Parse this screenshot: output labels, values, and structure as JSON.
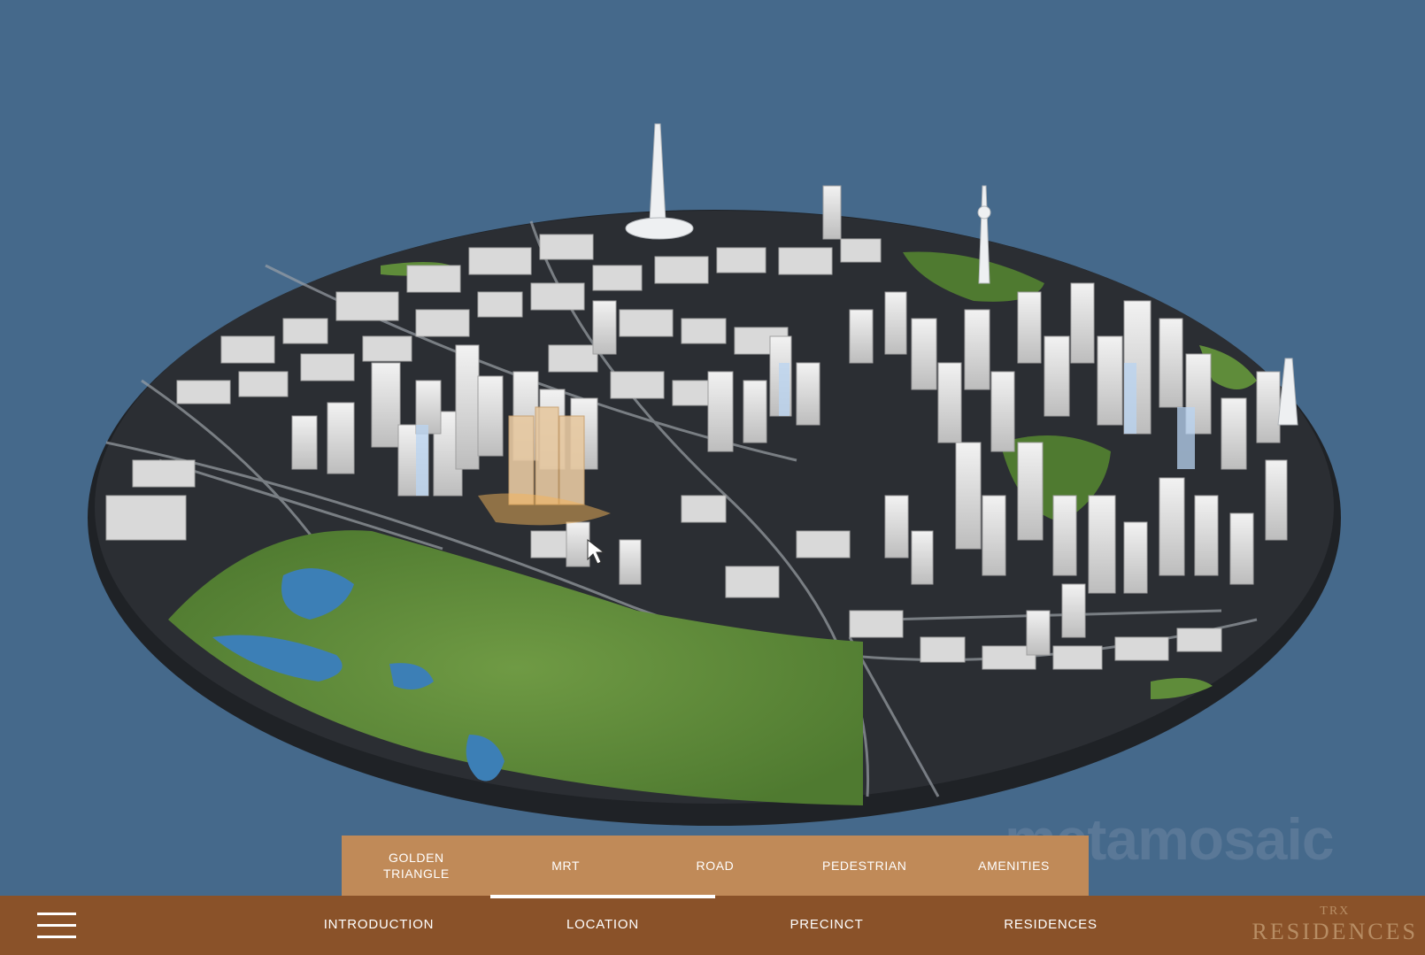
{
  "submenu": {
    "items": [
      {
        "label": "GOLDEN\nTRIANGLE"
      },
      {
        "label": "MRT"
      },
      {
        "label": "ROAD"
      },
      {
        "label": "PEDESTRIAN"
      },
      {
        "label": "AMENITIES"
      }
    ]
  },
  "nav": {
    "items": [
      {
        "label": "INTRODUCTION"
      },
      {
        "label": "LOCATION"
      },
      {
        "label": "PRECINCT"
      },
      {
        "label": "RESIDENCES"
      }
    ],
    "active": "LOCATION"
  },
  "brand": {
    "line1": "TRX",
    "line2": "RESIDENCES"
  },
  "watermark": "metamosaic",
  "colors": {
    "background": "#45698b",
    "submenu_bg": "#c08a58",
    "nav_bg": "#8a5229",
    "park_green": "#5f8c3a",
    "water_blue": "#3c7fb6"
  }
}
